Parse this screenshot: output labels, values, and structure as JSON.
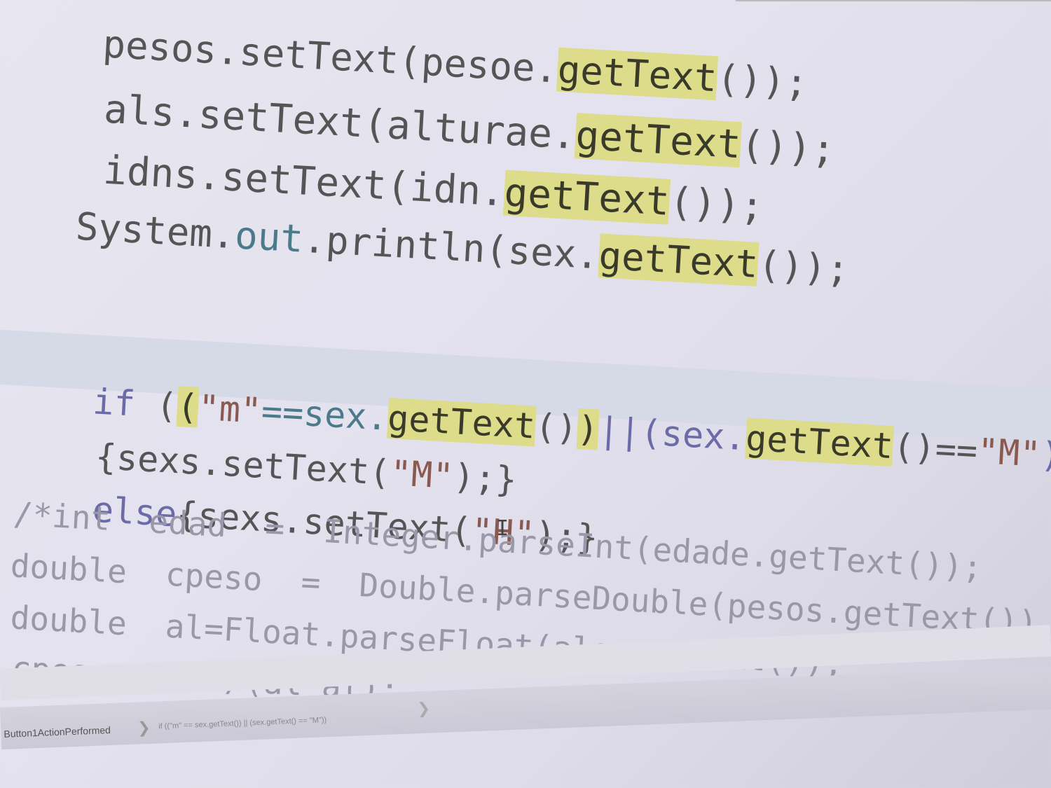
{
  "code_lines": {
    "l0": {
      "obj": "pesos",
      "dot": ".setText",
      "args_pre": "(pesoe.",
      "hl": "getText",
      "post": "());"
    },
    "l1": {
      "obj": "als",
      "dot": ".setText",
      "args_pre": "(alturae.",
      "hl": "getText",
      "post": "());"
    },
    "l2": {
      "obj": "idns",
      "dot": ".setText",
      "args_pre": "(idn.",
      "hl": "getText",
      "post": "());"
    },
    "l3": {
      "sys": "System.",
      "out": "out",
      "call": ".println(sex.",
      "hl": "getText",
      "post": "());"
    },
    "l4": {
      "kw": "if",
      "sp": " (",
      "hl_paren": "(",
      "str_m": "\"m\"",
      "eq": "==sex.",
      "hl": "getText",
      "mid": "()",
      "hl_paren2": ")",
      "or": "||(sex.",
      "hl2": "getText",
      "tail": "()==",
      "str_M": "\"M\"",
      "end": "))"
    },
    "l5": {
      "pre": "{sexs.setText(",
      "str": "\"M\"",
      "post": ");}"
    },
    "l6": {
      "kw": "else",
      "pre": "{sexs.setText(",
      "str": "\"H\"",
      "post": ");}"
    },
    "l7": {
      "text": "/*int  edad  =  Integer.parseInt(edade.getText());"
    },
    "l8": {
      "text": "double  cpeso  =  Double.parseDouble(pesos.getText())"
    },
    "l9": {
      "text": "double  al=Float.parseFloat(als.getText());"
    },
    "l10": {
      "text": "cpeso=cpeso/(al*al);"
    }
  },
  "breadcrumb": {
    "item1": "Button1ActionPerformed",
    "sep": "❯",
    "item2": "if ((\"m\" == sex.getText()) || (sex.getText() == \"M\"))"
  },
  "cursor": "I"
}
